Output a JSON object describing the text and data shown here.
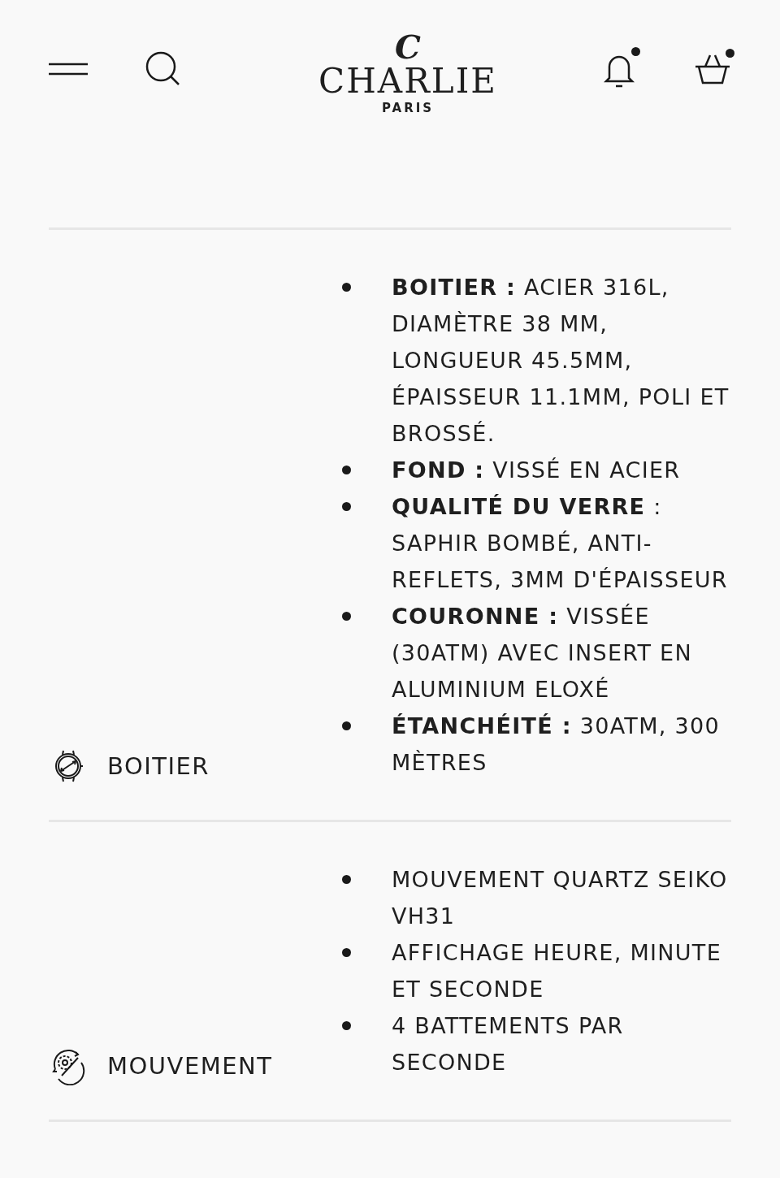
{
  "header": {
    "logo": {
      "mark": "C",
      "name": "CHARLIE",
      "city": "PARIS"
    },
    "notifications": {
      "unread": true
    },
    "cart": {
      "has_items": true
    }
  },
  "specs": [
    {
      "title": "BOITIER",
      "kind": "watch",
      "items": [
        "**BOITIER :** ACIER 316L, DIAMÈTRE 38 MM, LONGUEUR 45.5MM, ÉPAISSEUR 11.1MM, POLI ET BROSSÉ.",
        "**FOND :** VISSÉ EN ACIER",
        "**QUALITÉ DU VERRE** : SAPHIR BOMBÉ, ANTI-REFLETS, 3MM D'ÉPAISSEUR",
        "**COURONNE :** VISSÉE (30ATM) AVEC INSERT EN ALUMINIUM ELOXÉ",
        "**ÉTANCHÉITÉ :** 30ATM, 300 MÈTRES"
      ]
    },
    {
      "title": "MOUVEMENT",
      "kind": "movement",
      "items": [
        "MOUVEMENT QUARTZ SEIKO VH31",
        "AFFICHAGE HEURE, MINUTE ET SECONDE",
        "4 BATTEMENTS PAR SECONDE"
      ]
    }
  ]
}
